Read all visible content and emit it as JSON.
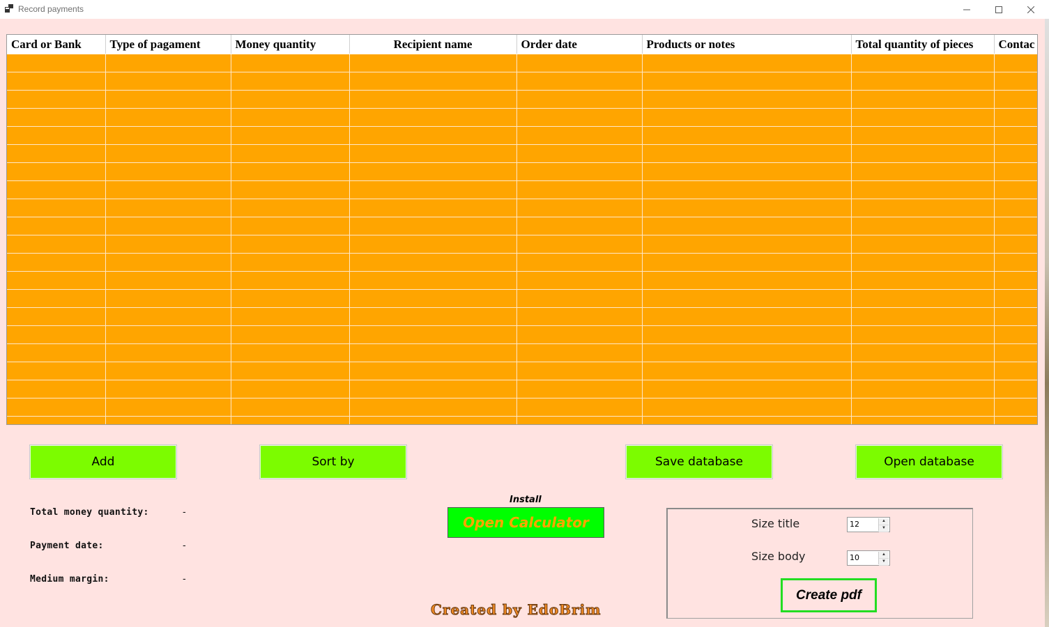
{
  "window": {
    "title": "Record payments",
    "controls": {
      "minimize": "—",
      "maximize": "☐",
      "close": "✕"
    }
  },
  "table": {
    "columns": [
      "Card or Bank",
      "Type of pagament",
      "Money quantity",
      "Recipient name",
      "Order date",
      "Products or notes",
      "Total quantity of pieces",
      "Contac"
    ],
    "row_fill_color": "#ffa500",
    "rows": []
  },
  "buttons": {
    "add": "Add",
    "sort_by": "Sort by",
    "save_database": "Save database",
    "open_database": "Open database",
    "color": "#7cfc00"
  },
  "stats": {
    "total_money_quantity": {
      "label": "Total money quantity:",
      "value": "-"
    },
    "payment_date": {
      "label": "Payment date:",
      "value": "-"
    },
    "medium_margin": {
      "label": "Medium margin:",
      "value": "-"
    }
  },
  "calculator": {
    "install_label": "Install",
    "open_label": "Open Calculator"
  },
  "credit": "Created by EdoBrim",
  "pdf": {
    "size_title_label": "Size title",
    "size_title_value": "12",
    "size_body_label": "Size body",
    "size_body_value": "10",
    "create_label": "Create pdf"
  }
}
